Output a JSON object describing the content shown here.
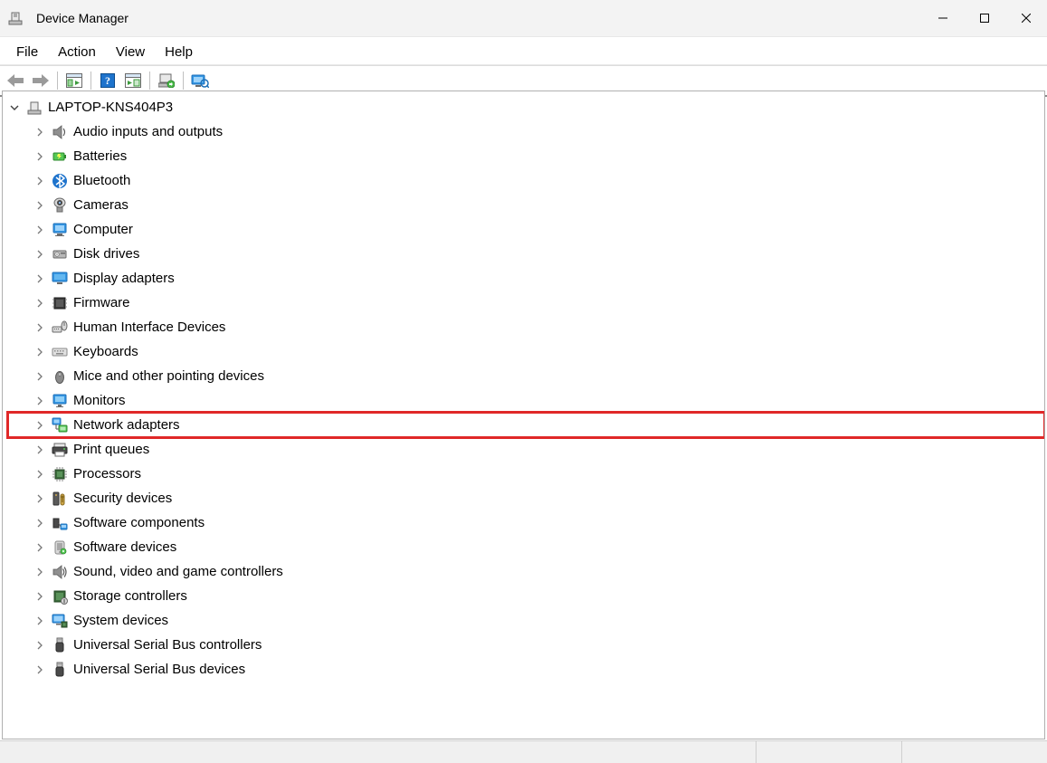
{
  "window": {
    "title": "Device Manager"
  },
  "menu": {
    "file": "File",
    "action": "Action",
    "view": "View",
    "help": "Help"
  },
  "toolbar": {
    "back": "Back",
    "forward": "Forward",
    "show_hide": "Show/Hide Console Tree",
    "help": "Help",
    "properties": "Properties",
    "update": "Update",
    "scan": "Scan for hardware changes"
  },
  "tree": {
    "root": {
      "label": "LAPTOP-KNS404P3",
      "expanded": true
    },
    "items": [
      {
        "label": "Audio inputs and outputs",
        "icon": "audio"
      },
      {
        "label": "Batteries",
        "icon": "battery"
      },
      {
        "label": "Bluetooth",
        "icon": "bluetooth"
      },
      {
        "label": "Cameras",
        "icon": "camera"
      },
      {
        "label": "Computer",
        "icon": "computer"
      },
      {
        "label": "Disk drives",
        "icon": "disk"
      },
      {
        "label": "Display adapters",
        "icon": "display"
      },
      {
        "label": "Firmware",
        "icon": "firmware"
      },
      {
        "label": "Human Interface Devices",
        "icon": "hid"
      },
      {
        "label": "Keyboards",
        "icon": "keyboard"
      },
      {
        "label": "Mice and other pointing devices",
        "icon": "mouse"
      },
      {
        "label": "Monitors",
        "icon": "monitor"
      },
      {
        "label": "Network adapters",
        "icon": "network",
        "highlighted": true
      },
      {
        "label": "Print queues",
        "icon": "printer"
      },
      {
        "label": "Processors",
        "icon": "cpu"
      },
      {
        "label": "Security devices",
        "icon": "security"
      },
      {
        "label": "Software components",
        "icon": "software-comp"
      },
      {
        "label": "Software devices",
        "icon": "software-dev"
      },
      {
        "label": "Sound, video and game controllers",
        "icon": "sound"
      },
      {
        "label": "Storage controllers",
        "icon": "storage"
      },
      {
        "label": "System devices",
        "icon": "system"
      },
      {
        "label": "Universal Serial Bus controllers",
        "icon": "usb"
      },
      {
        "label": "Universal Serial Bus devices",
        "icon": "usb"
      }
    ]
  }
}
